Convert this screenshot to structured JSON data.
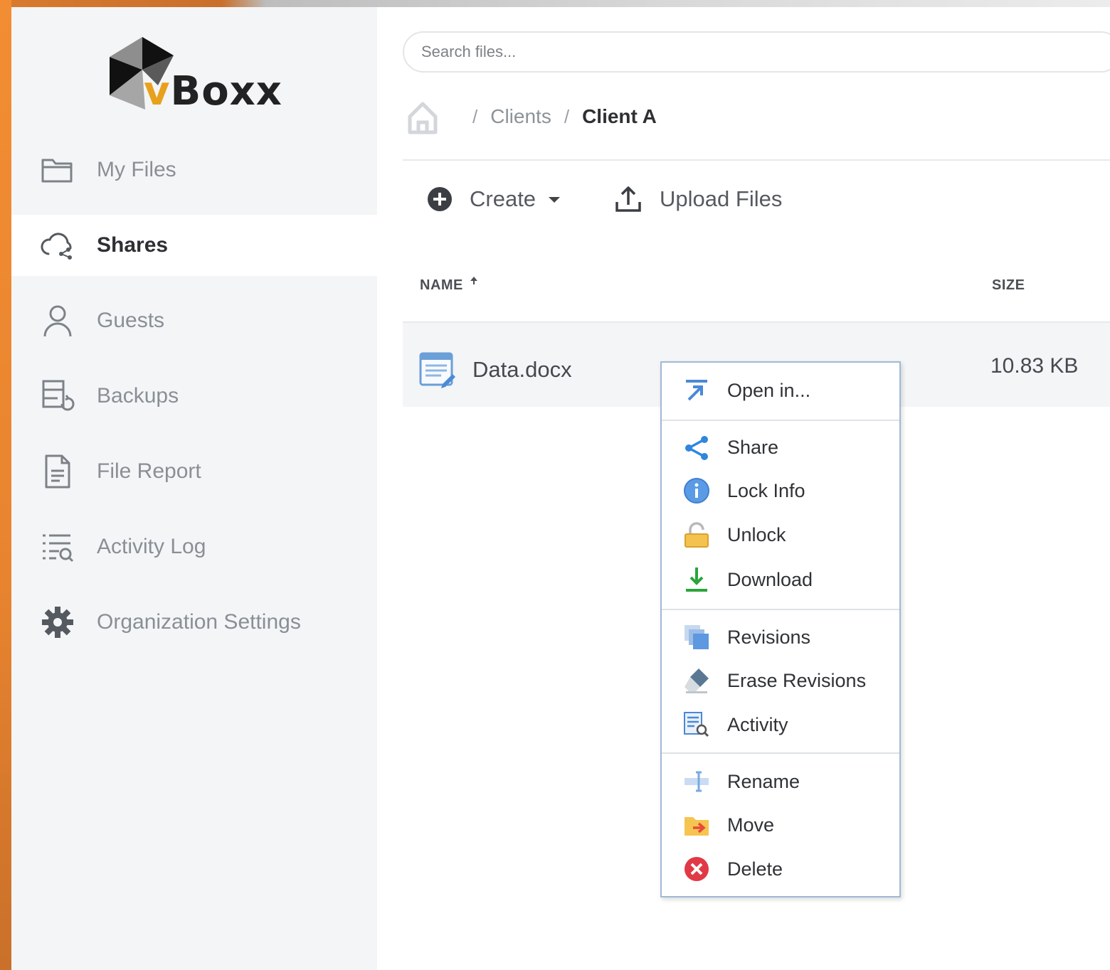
{
  "app": {
    "logo_text_v": "v",
    "logo_text_rest": "Boxx"
  },
  "sidebar": {
    "items": [
      {
        "label": "My Files",
        "icon": "folder-icon",
        "active": false
      },
      {
        "label": "Shares",
        "icon": "cloud-share-icon",
        "active": true
      },
      {
        "label": "Guests",
        "icon": "user-icon",
        "active": false
      },
      {
        "label": "Backups",
        "icon": "backup-icon",
        "active": false
      },
      {
        "label": "File Report",
        "icon": "document-icon",
        "active": false
      },
      {
        "label": "Activity Log",
        "icon": "list-search-icon",
        "active": false
      },
      {
        "label": "Organization Settings",
        "icon": "gear-icon",
        "active": false
      }
    ]
  },
  "search": {
    "placeholder": "Search files..."
  },
  "breadcrumb": {
    "sep": "/",
    "items": [
      "Clients",
      "Client A"
    ]
  },
  "toolbar": {
    "create_label": "Create",
    "upload_label": "Upload Files"
  },
  "table": {
    "headers": {
      "name": "NAME",
      "size": "SIZE"
    },
    "rows": [
      {
        "name": "Data.docx",
        "size": "10.83 KB",
        "icon": "docx-file-icon"
      }
    ]
  },
  "context_menu": {
    "items": [
      {
        "label": "Open in...",
        "icon": "open-in-icon"
      },
      {
        "label": "Share",
        "icon": "share-icon"
      },
      {
        "label": "Lock Info",
        "icon": "info-icon"
      },
      {
        "label": "Unlock",
        "icon": "unlock-icon"
      },
      {
        "label": "Download",
        "icon": "download-icon"
      },
      {
        "label": "Revisions",
        "icon": "revisions-icon"
      },
      {
        "label": "Erase Revisions",
        "icon": "eraser-icon"
      },
      {
        "label": "Activity",
        "icon": "activity-icon"
      },
      {
        "label": "Rename",
        "icon": "rename-icon"
      },
      {
        "label": "Move",
        "icon": "move-icon"
      },
      {
        "label": "Delete",
        "icon": "delete-icon"
      }
    ]
  },
  "colors": {
    "accent_orange": "#e8a11c",
    "sidebar_bg": "#f4f5f7",
    "menu_border": "#9fb9d6"
  }
}
